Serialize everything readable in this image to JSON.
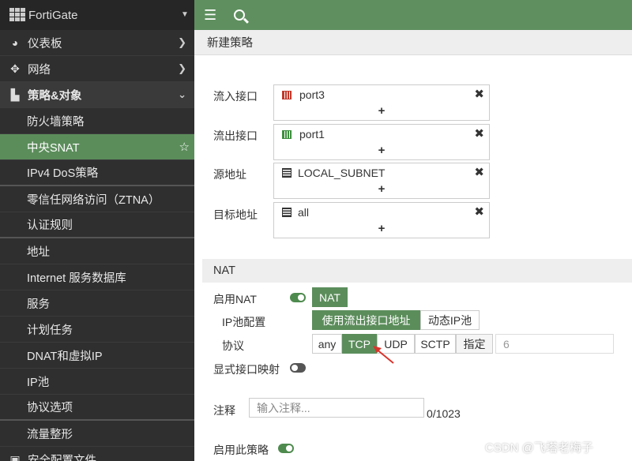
{
  "brand": "FortiGate",
  "sidebar": {
    "top_items": [
      {
        "label": "仪表板",
        "icon": "dashboard-icon"
      },
      {
        "label": "网络",
        "icon": "network-arrows-icon"
      },
      {
        "label": "策略&对象",
        "icon": "policy-document-icon"
      }
    ],
    "sub_items": [
      "防火墙策略",
      "中央SNAT",
      "IPv4 DoS策略",
      "零信任网络访问（ZTNA）",
      "认证规则",
      "地址",
      "Internet 服务数据库",
      "服务",
      "计划任务",
      "DNAT和虚拟IP",
      "IP池",
      "协议选项",
      "流量整形",
      "安全配置文件"
    ],
    "active_item": "中央SNAT"
  },
  "page_title": "新建策略",
  "form": {
    "incoming_label": "流入接口",
    "incoming_value": "port3",
    "outgoing_label": "流出接口",
    "outgoing_value": "port1",
    "source_label": "源地址",
    "source_value": "LOCAL_SUBNET",
    "dest_label": "目标地址",
    "dest_value": "all",
    "plus": "+",
    "remove": "✖"
  },
  "nat": {
    "section_title": "NAT",
    "enable_label": "启用NAT",
    "enable_on": true,
    "nat_button": "NAT",
    "ip_pool_label": "IP池配置",
    "ip_pool_options": [
      "使用流出接口地址",
      "动态IP池"
    ],
    "ip_pool_selected": "使用流出接口地址",
    "protocol_label": "协议",
    "protocol_options": [
      "any",
      "TCP",
      "UDP",
      "SCTP",
      "指定"
    ],
    "protocol_selected": "TCP",
    "protocol_number": "6",
    "explicit_port_label": "显式接口映射",
    "explicit_port_on": false
  },
  "comment": {
    "label": "注释",
    "placeholder": "输入注释...",
    "counter": "0/1023"
  },
  "enable_policy": {
    "label": "启用此策略",
    "on": true
  },
  "watermark": "CSDN @飞塔老梅子",
  "colors": {
    "accent": "#5b8d5b",
    "sidebar_bg": "#2f2f2f",
    "arrow": "#d9342b"
  }
}
